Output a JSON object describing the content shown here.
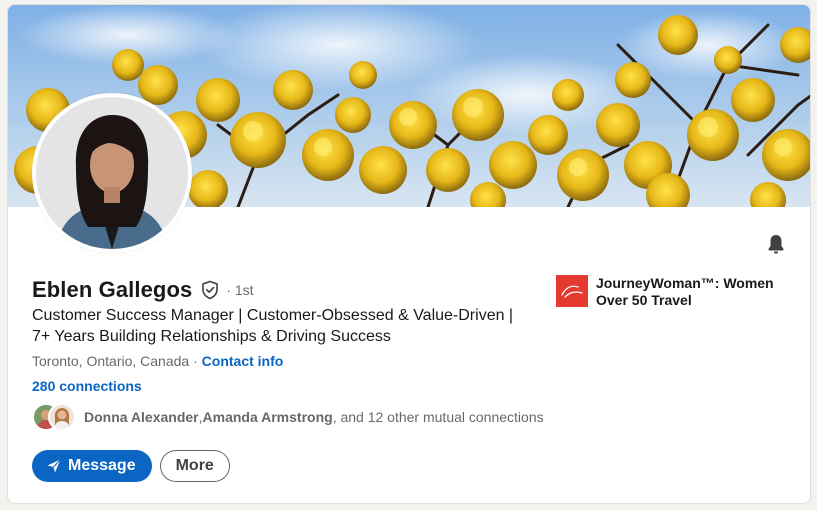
{
  "profile": {
    "name": "Eblen Gallegos",
    "degree": "· 1st",
    "headline": "Customer Success Manager | Customer-Obsessed & Value-Driven | 7+ Years Building Relationships & Driving Success",
    "location": "Toronto, Ontario, Canada",
    "location_sep": " · ",
    "contact_info": "Contact info",
    "connections": "280 connections"
  },
  "mutual": {
    "person1": "Donna Alexander",
    "sep": ", ",
    "person2": "Amanda Armstrong",
    "rest": ", and 12 other mutual connections"
  },
  "company": {
    "name": "JourneyWoman™: Women Over 50 Travel"
  },
  "actions": {
    "message_label": "Message",
    "more_label": "More"
  },
  "icons": {
    "bell": "bell-icon",
    "verified": "verified-shield-icon",
    "send": "send-icon"
  },
  "colors": {
    "accent": "#0a66c2",
    "company_logo": "#e53a2f"
  }
}
